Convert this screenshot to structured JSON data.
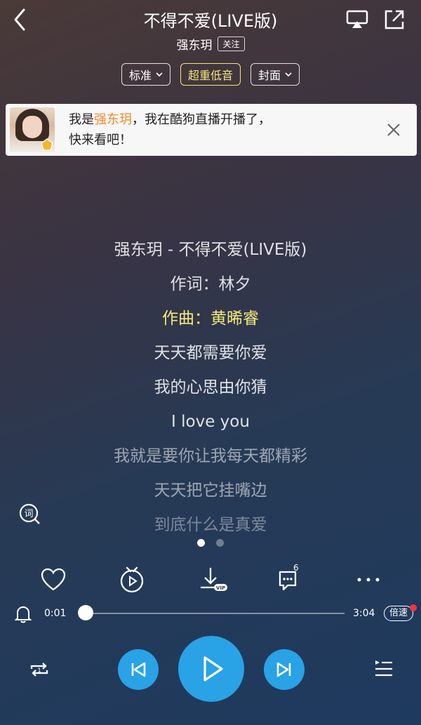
{
  "header": {
    "title": "不得不爱(LIVE版)",
    "artist": "强东玥",
    "follow_label": "关注"
  },
  "chips": [
    {
      "label": "标准",
      "has_dropdown": true,
      "highlight": false
    },
    {
      "label": "超重低音",
      "has_dropdown": false,
      "highlight": true
    },
    {
      "label": "封面",
      "has_dropdown": true,
      "highlight": false
    }
  ],
  "banner": {
    "text_prefix": "我是",
    "name": "强东玥",
    "text_suffix": "，我在酷狗直播开播了，",
    "line2": "快来看吧！"
  },
  "lyrics": [
    {
      "text": "强东玥 - 不得不爱(LIVE版)",
      "state": "normal"
    },
    {
      "text": "作词：林夕",
      "state": "normal"
    },
    {
      "text": "作曲：黄晞睿",
      "state": "active"
    },
    {
      "text": "天天都需要你爱",
      "state": "normal"
    },
    {
      "text": "我的心思由你猜",
      "state": "normal"
    },
    {
      "text": "I love you",
      "state": "normal"
    },
    {
      "text": "我就是要你让我每天都精彩",
      "state": "fade"
    },
    {
      "text": "天天把它挂嘴边",
      "state": "fade"
    },
    {
      "text": "到底什么是真爱",
      "state": "fade2"
    }
  ],
  "actions": {
    "comment_count": "6",
    "vip_label": "VIP"
  },
  "progress": {
    "current": "0:01",
    "total": "3:04",
    "speed_label": "倍速",
    "fraction": 0.005
  },
  "colors": {
    "accent": "#29a2e6",
    "active_lyric": "#f4ea7c",
    "banner_name": "#f08a2c"
  }
}
